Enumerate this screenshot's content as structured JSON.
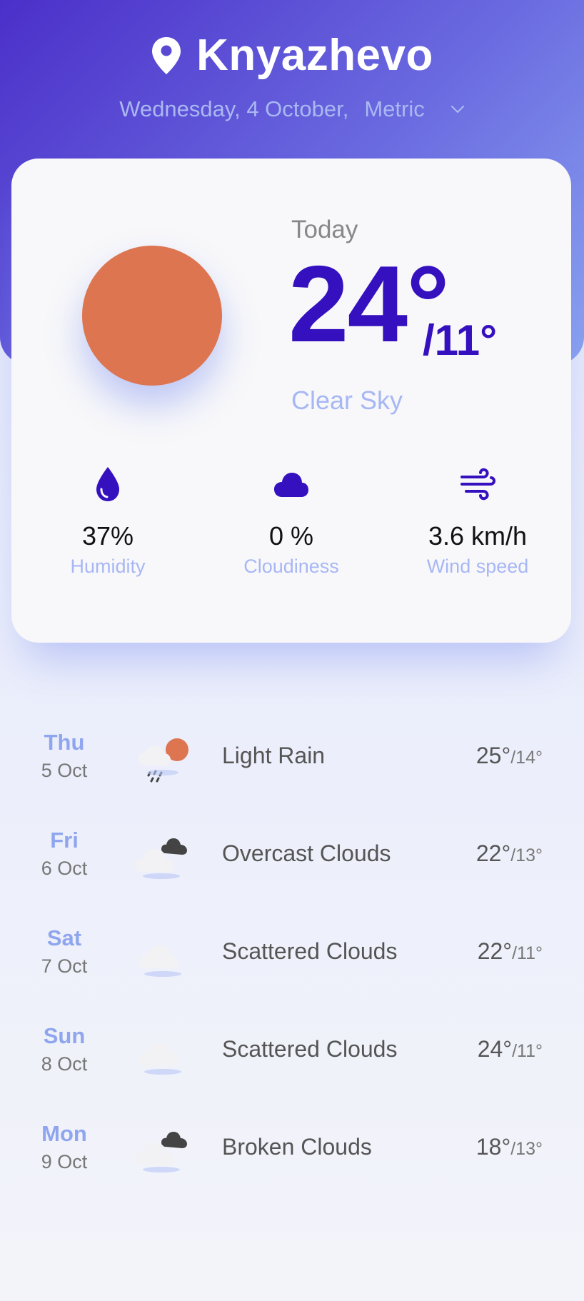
{
  "header": {
    "city": "Knyazhevo",
    "date": "Wednesday, 4 October,",
    "units": "Metric"
  },
  "today": {
    "label": "Today",
    "temp_max": "24°",
    "temp_min": "/11°",
    "condition": "Clear Sky",
    "stats": [
      {
        "icon": "droplet-icon",
        "value": "37%",
        "label": "Humidity"
      },
      {
        "icon": "cloud-icon",
        "value": "0 %",
        "label": "Cloudiness"
      },
      {
        "icon": "wind-icon",
        "value": "3.6 km/h",
        "label": "Wind speed"
      }
    ]
  },
  "forecast": [
    {
      "day": "Thu",
      "date": "5 Oct",
      "icon": "light-rain-icon",
      "description": "Light Rain",
      "max": "25°",
      "min": "/14°"
    },
    {
      "day": "Fri",
      "date": "6 Oct",
      "icon": "overcast-clouds-icon",
      "description": "Overcast Clouds",
      "max": "22°",
      "min": "/13°"
    },
    {
      "day": "Sat",
      "date": "7 Oct",
      "icon": "scattered-clouds-icon",
      "description": "Scattered Clouds",
      "max": "22°",
      "min": "/11°"
    },
    {
      "day": "Sun",
      "date": "8 Oct",
      "icon": "scattered-clouds-icon",
      "description": "Scattered Clouds",
      "max": "24°",
      "min": "/11°"
    },
    {
      "day": "Mon",
      "date": "9 Oct",
      "icon": "broken-clouds-icon",
      "description": "Broken Clouds",
      "max": "18°",
      "min": "/13°"
    }
  ],
  "colors": {
    "accent": "#3510bf",
    "header_start": "#4b2fc9",
    "header_end": "#8aa3f0",
    "sun": "#dd7551",
    "label_light": "#a7b7f4"
  }
}
